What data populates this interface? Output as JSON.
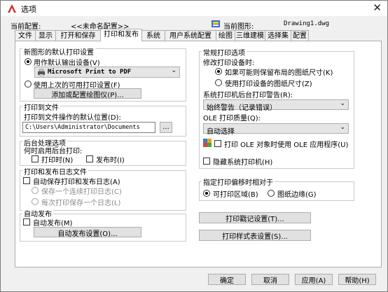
{
  "window": {
    "title": "选项",
    "close_glyph": "✕"
  },
  "profile": {
    "label": "当前配置:",
    "value": "<<未命名配置>>"
  },
  "drawing": {
    "label": "当前图形:",
    "value": "Drawing1.dwg"
  },
  "tabs": [
    {
      "label": "文件"
    },
    {
      "label": "显示"
    },
    {
      "label": "打开和保存"
    },
    {
      "label": "打印和发布",
      "active": true
    },
    {
      "label": "系统"
    },
    {
      "label": "用户系统配置"
    },
    {
      "label": "绘图"
    },
    {
      "label": "三维建模"
    },
    {
      "label": "选择集"
    },
    {
      "label": "配置"
    }
  ],
  "default_settings": {
    "title": "新图形的默认打印设置",
    "use_default_device": "用作默认输出设备(V)",
    "device": "Microsoft Print to PDF",
    "use_last_device": "使用上次的可用打印设置(F)",
    "add_plotter_button": "添加或配置绘图仪(P)..."
  },
  "plot_to_file": {
    "title": "打印到文件",
    "location_label": "打印到文件操作的默认位置(D):",
    "location_value": "C:\\Users\\Administrator\\Documents",
    "browse_button": "..."
  },
  "background": {
    "title": "后台处理选项",
    "enable_label": "何时启用后台打印:",
    "plotting": "打印时(N)",
    "publishing": "发布时(I)"
  },
  "log": {
    "title": "打印和发布日志文件",
    "auto_save": "自动保存打印和发布日志(A)",
    "continuous": "保存一个连续打印日志(C)",
    "per_plot": "每次打印保存一个日志(L)"
  },
  "autopublish": {
    "title": "自动发布",
    "auto": "自动发布(M)",
    "settings_button": "自动发布设置(O)..."
  },
  "general": {
    "title": "常规打印选项",
    "change_device_label": "修改打印设备时:",
    "keep_paper": "如果可能则保留布局的图纸尺寸(K)",
    "use_device_paper": "使用打印设备的图纸尺寸(Z)",
    "spool_alert_label": "系统打印机后台打印警告(R):",
    "spool_alert_value": "始终警告（记录错误）",
    "ole_quality_label": "OLE 打印质量(Q):",
    "ole_quality_value": "自动选择",
    "use_ole_app": "打印 OLE 对象时使用 OLE 应用程序(U)",
    "hide_system_printers": "隐藏系统打印机(H)"
  },
  "offset": {
    "title": "指定打印偏移时相对于",
    "printable": "可打印区域(B)",
    "edge": "图纸边缘(G)"
  },
  "stamp_button": "打印戳记设置(T)...",
  "style_table_button": "打印样式表设置(S)...",
  "footer": {
    "ok": "确定",
    "cancel": "取消",
    "apply": "应用(A)",
    "help": "帮助(H)"
  },
  "colors": {
    "accent": "#d62b2b",
    "tab_border": "#adadad",
    "background": "#2b2d31"
  }
}
